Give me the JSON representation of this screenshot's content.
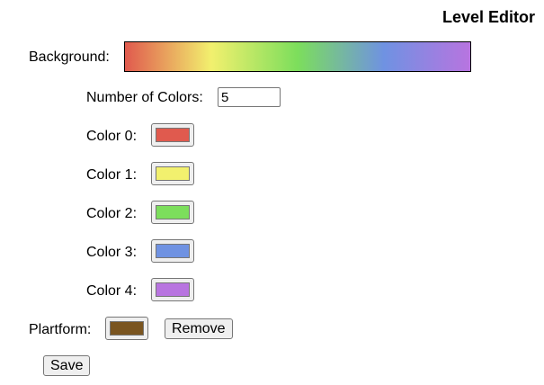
{
  "header": {
    "title": "Level Editor"
  },
  "background": {
    "label": "Background:",
    "gradient_colors": [
      "#e05a4e",
      "#f2f06e",
      "#7cde5c",
      "#6f92e2",
      "#b874e0"
    ]
  },
  "num_colors": {
    "label": "Number of Colors:",
    "value": "5"
  },
  "colors": [
    {
      "label": "Color 0:",
      "value": "#e05a4e"
    },
    {
      "label": "Color 1:",
      "value": "#f2f06e"
    },
    {
      "label": "Color 2:",
      "value": "#7cde5c"
    },
    {
      "label": "Color 3:",
      "value": "#6f92e2"
    },
    {
      "label": "Color 4:",
      "value": "#b874e0"
    }
  ],
  "platform": {
    "label": "Plartform:",
    "color": "#7a5520",
    "remove_label": "Remove"
  },
  "actions": {
    "save_label": "Save"
  }
}
